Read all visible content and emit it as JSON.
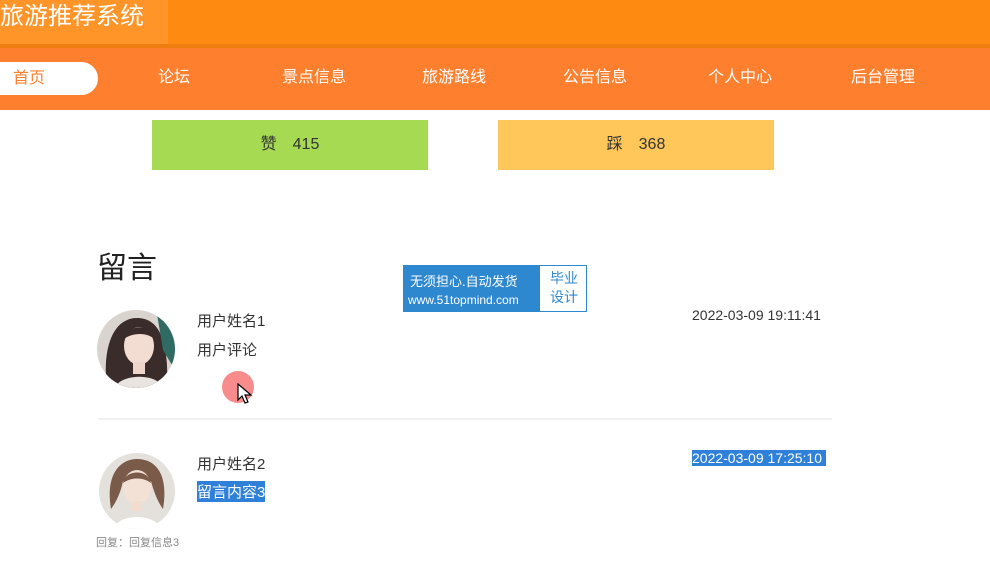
{
  "app": {
    "title": "旅游推荐系统"
  },
  "nav": {
    "home": "首页",
    "items": [
      "论坛",
      "景点信息",
      "旅游路线",
      "公告信息",
      "个人中心",
      "后台管理"
    ]
  },
  "votes": {
    "like": {
      "label": "赞",
      "count": "415"
    },
    "dislike": {
      "label": "踩",
      "count": "368"
    }
  },
  "comments": {
    "heading": "留言",
    "items": [
      {
        "name": "用户姓名1",
        "text": "用户评论",
        "time": "2022-03-09 19:11:41"
      },
      {
        "name": "用户姓名2",
        "text": "留言内容3",
        "time": "2022-03-09 17:25:10",
        "reply": "回复：回复信息3"
      }
    ]
  },
  "watermark": {
    "line1": "无须担心.自动发货",
    "line2": "www.51topmind.com",
    "right_line1": "毕业",
    "right_line2": "设计"
  },
  "colors": {
    "header": "#ff8a12",
    "nav": "#fe7f2e",
    "like": "#a6da53",
    "dislike": "#ffc759",
    "selection": "#2f80d8"
  }
}
